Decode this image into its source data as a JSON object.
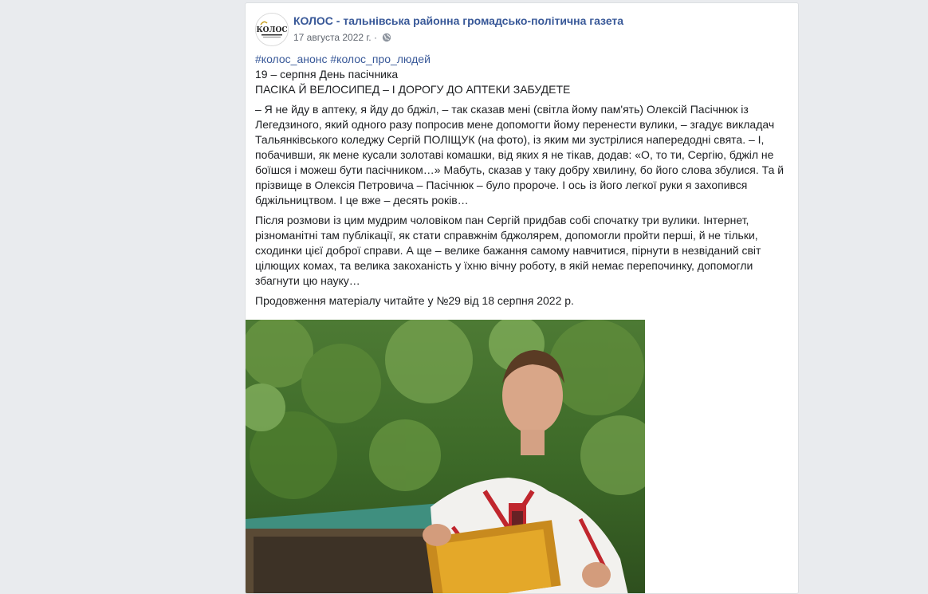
{
  "post": {
    "page_name": "КОЛОС - тальнівська районна громадсько-політична газета",
    "avatar_text": "КОЛОС",
    "date": "17 августа 2022 г.",
    "separator": "·",
    "privacy_icon": "globe-icon",
    "hashtags": [
      "#колос_анонс",
      "#колос_про_людей"
    ],
    "line1": "19 – серпня День пасічника",
    "headline": "ПАСІКА Й ВЕЛОСИПЕД – І ДОРОГУ ДО АПТЕКИ ЗАБУДЕТЕ",
    "paragraph1": "– Я не йду в аптеку, я йду до бджіл, – так сказав мені (світла йому пам'ять) Олексій Пасічнюк із Легедзиного, який одного разу попросив мене допомогти йому перенести вулики, – згадує викладач Тальянківського коледжу Сергій ПОЛІЩУК (на фото), із яким ми зустрілися напередодні свята. – І, побачивши, як мене кусали золотаві комашки, від яких я не тікав, додав: «О, то ти, Сергію, бджіл не боїшся і можеш бути пасічником…» Мабуть, сказав у таку добру хвилину, бо його слова збулися. Та й прізвище в Олексія Петровича – Пасічнюк – було пророче. І ось із його легкої руки я захопився бджільництвом. І це вже – десять років…",
    "paragraph2": "Після розмови із цим мудрим чоловіком пан Сергій придбав собі спочатку три вулики. Інтернет, різноманітні там публікації, як стати справжнім бджолярем, допомогли пройти перші, й не тільки, сходинки цієї доброї справи. А ще – велике бажання самому навчитися, пірнути в незвіданий світ цілющих комах, та велика закоханість у їхню вічну роботу, в якій немає перепочинку, допомогли збагнути цю науку…",
    "paragraph3": "Продовження матеріалу читайте у №29 від 18 серпня 2022 р."
  },
  "colors": {
    "link": "#385898",
    "background": "#e9ebee",
    "text": "#1c1e21",
    "meta": "#616770"
  }
}
